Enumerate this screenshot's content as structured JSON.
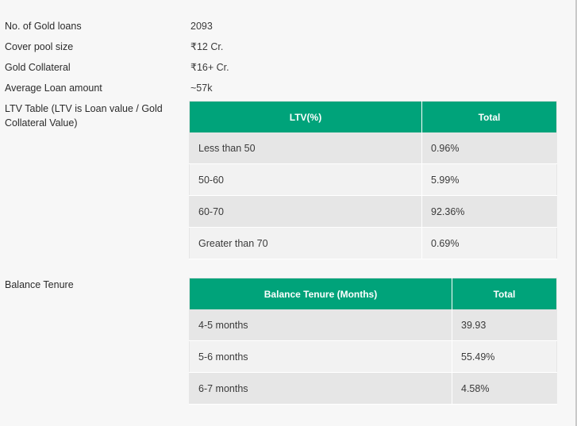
{
  "summary": [
    {
      "label": "No. of Gold loans",
      "value": "2093"
    },
    {
      "label": "Cover pool size",
      "value": "₹12 Cr."
    },
    {
      "label": "Gold Collateral",
      "value": "₹16+ Cr."
    },
    {
      "label": "Average Loan amount",
      "value": "~57k"
    }
  ],
  "ltv": {
    "label_line1": "LTV Table (LTV is Loan value / Gold",
    "label_line2": "Collateral Value)",
    "headers": [
      "LTV(%)",
      "Total"
    ],
    "rows": [
      [
        "Less than 50",
        "0.96%"
      ],
      [
        "50-60",
        "5.99%"
      ],
      [
        "60-70",
        "92.36%"
      ],
      [
        "Greater than 70",
        "0.69%"
      ]
    ]
  },
  "tenure": {
    "label": "Balance Tenure",
    "headers": [
      "Balance Tenure (Months)",
      "Total"
    ],
    "rows": [
      [
        "4-5 months",
        "39.93"
      ],
      [
        "5-6 months",
        "55.49%"
      ],
      [
        "6-7 months",
        "4.58%"
      ]
    ]
  },
  "colors": {
    "header_green": "#00a37a",
    "row_dark": "#e6e6e6",
    "row_light": "#f2f2f2"
  }
}
